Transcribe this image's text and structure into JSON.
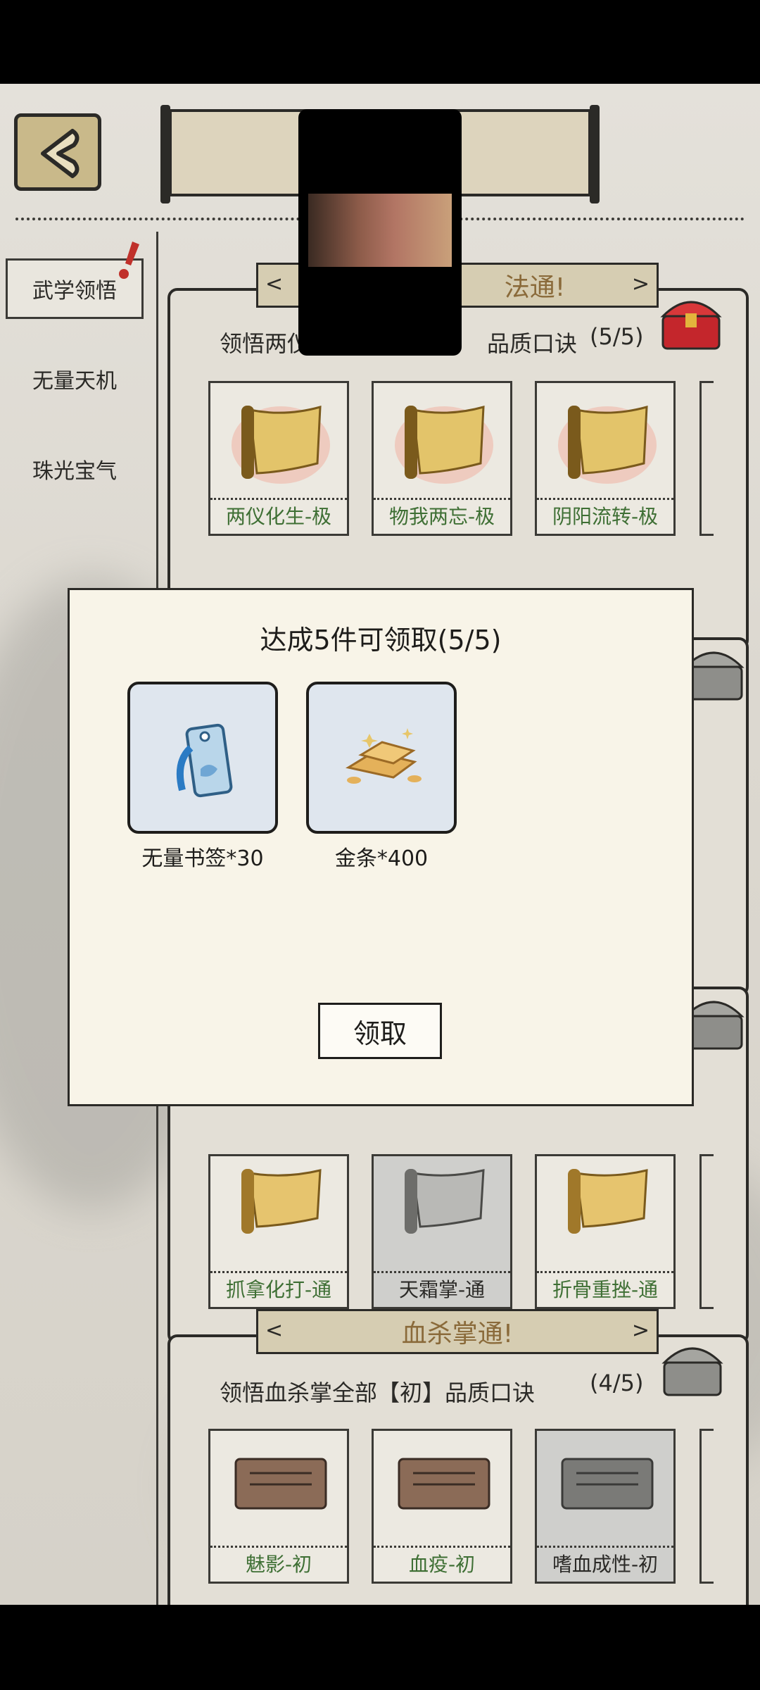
{
  "nav": {
    "tabs": [
      {
        "label": "武学领悟",
        "active": true,
        "badge": true
      },
      {
        "label": "无量天机",
        "active": false
      },
      {
        "label": "珠光宝气",
        "active": false
      }
    ]
  },
  "panels": [
    {
      "banner": "法通!",
      "subtitle_a": "领悟两仪",
      "subtitle_b": "品质口诀",
      "progress": "(5/5)",
      "chest": "red-treasure-chest-icon",
      "cards": [
        {
          "label": "两仪化生-极",
          "icon": "golden-scroll-icon",
          "grey": false
        },
        {
          "label": "物我两忘-极",
          "icon": "golden-scroll-icon",
          "grey": false
        },
        {
          "label": "阴阳流转-极",
          "icon": "golden-scroll-icon",
          "grey": false
        }
      ]
    },
    {
      "cards": [
        {
          "label": "抓拿化打-通",
          "icon": "yellow-scroll-icon",
          "grey": false
        },
        {
          "label": "天霜掌-通",
          "icon": "grey-scroll-icon",
          "grey": true
        },
        {
          "label": "折骨重挫-通",
          "icon": "yellow-scroll-icon",
          "grey": false
        }
      ]
    },
    {
      "banner": "血杀掌通!",
      "subtitle": "领悟血杀掌全部【初】品质口诀",
      "progress": "(4/5)",
      "chest": "grey-treasure-chest-icon",
      "cards": [
        {
          "label": "魅影-初",
          "icon": "brown-tablet-icon",
          "grey": false
        },
        {
          "label": "血疫-初",
          "icon": "brown-tablet-icon",
          "grey": false
        },
        {
          "label": "嗜血成性-初",
          "icon": "grey-tablet-icon",
          "grey": true
        }
      ]
    }
  ],
  "dialog": {
    "title": "达成5件可领取(5/5)",
    "rewards": [
      {
        "label": "无量书签*30",
        "icon": "bookmark-icon"
      },
      {
        "label": "金条*400",
        "icon": "gold-bars-icon"
      }
    ],
    "claim_label": "领取"
  },
  "colors": {
    "accent": "#8a6a3a",
    "complete_text": "#3e6f34",
    "ink": "#2b2a27"
  }
}
